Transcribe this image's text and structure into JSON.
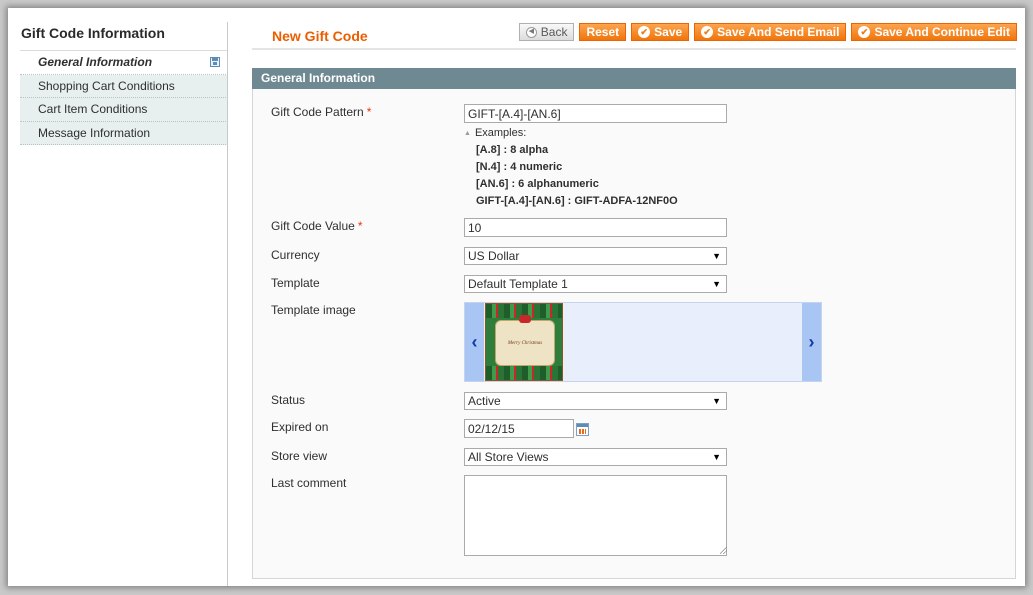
{
  "sidebar": {
    "title": "Gift Code Information",
    "tabs": [
      {
        "label": "General Information",
        "active": true
      },
      {
        "label": "Shopping Cart Conditions",
        "active": false
      },
      {
        "label": "Cart Item Conditions",
        "active": false
      },
      {
        "label": "Message Information",
        "active": false
      }
    ]
  },
  "header": {
    "title": "New Gift Code",
    "buttons": {
      "back": "Back",
      "reset": "Reset",
      "save": "Save",
      "save_send_email": "Save And Send Email",
      "save_continue": "Save And Continue Edit"
    }
  },
  "form": {
    "section_title": "General Information",
    "gift_code_pattern": {
      "label": "Gift Code Pattern",
      "required_mark": "*",
      "value": "GIFT-[A.4]-[AN.6]"
    },
    "examples": {
      "heading": "Examples:",
      "lines": [
        "[A.8] : 8 alpha",
        "[N.4] : 4 numeric",
        "[AN.6] : 6 alphanumeric",
        "GIFT-[A.4]-[AN.6] : GIFT-ADFA-12NF0O"
      ]
    },
    "gift_code_value": {
      "label": "Gift Code Value",
      "required_mark": "*",
      "value": "10"
    },
    "currency": {
      "label": "Currency",
      "value": "US Dollar"
    },
    "template": {
      "label": "Template",
      "value": "Default Template 1"
    },
    "template_image": {
      "label": "Template image",
      "card_text": "Merry Christmas"
    },
    "status": {
      "label": "Status",
      "value": "Active"
    },
    "expired_on": {
      "label": "Expired on",
      "value": "02/12/15"
    },
    "store_view": {
      "label": "Store view",
      "value": "All Store Views"
    },
    "last_comment": {
      "label": "Last comment",
      "value": ""
    }
  },
  "colors": {
    "accent": "#eb5e00",
    "button": "#f0750b",
    "section_header": "#6f8992",
    "required": "#eb340a"
  }
}
